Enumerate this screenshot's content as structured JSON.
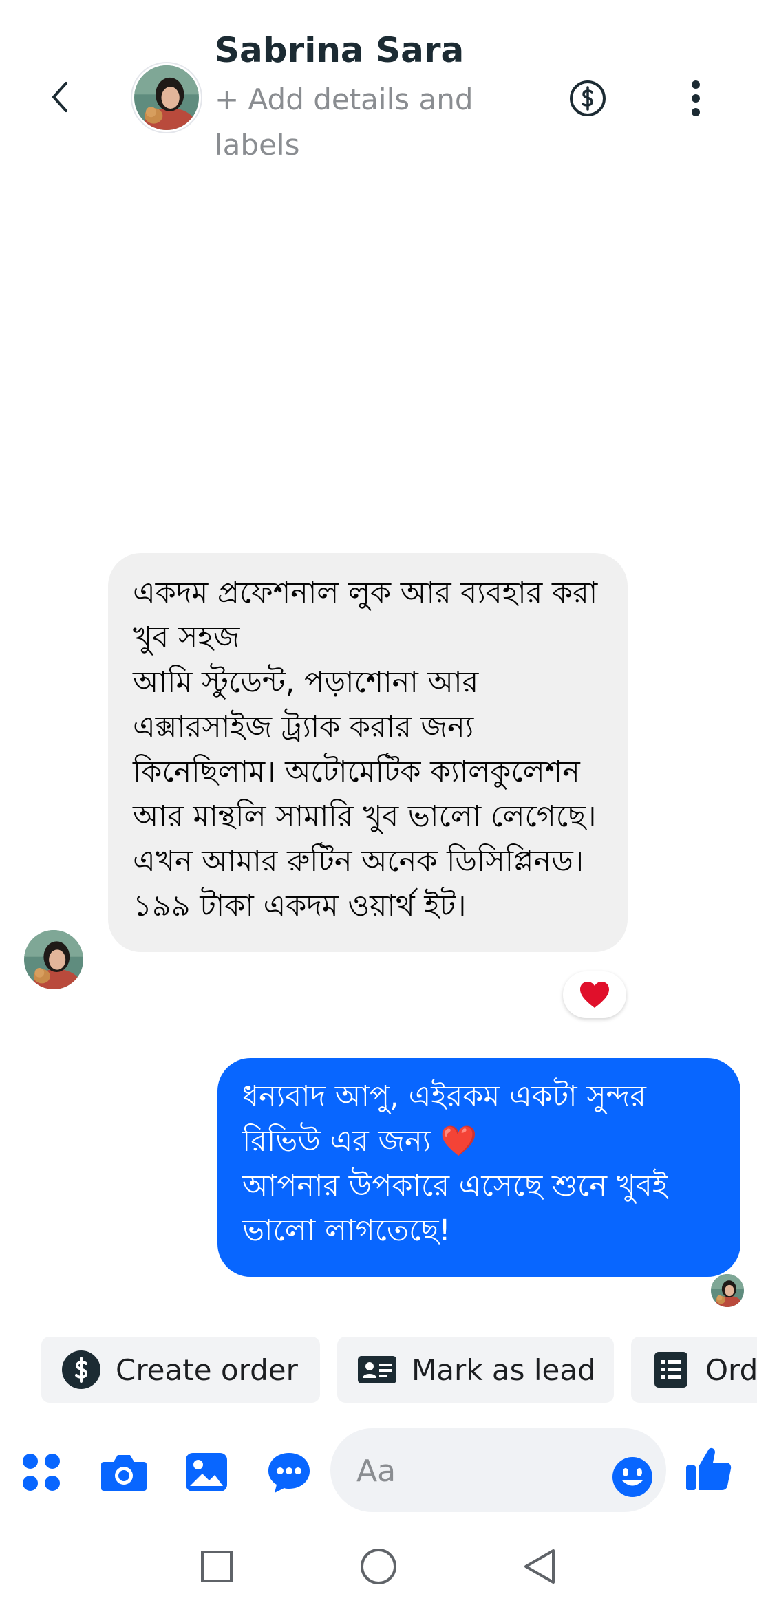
{
  "header": {
    "back_icon": "chevron-left-icon",
    "contact_name": "Sabrina Sara",
    "add_details": "+ Add details and labels",
    "payment_icon": "dollar-circle-icon",
    "menu_icon": "kebab-menu-icon"
  },
  "messages": [
    {
      "direction": "incoming",
      "text": "একদম প্রফেশনাল লুক আর ব্যবহার করা খুব সহজ\nআমি স্টুডেন্ট, পড়াশোনা আর এক্সারসাইজ ট্র্যাক করার জন্য কিনেছিলাম। অটোমেটিক ক্যালকুলেশন আর মান্থলি সামারি খুব ভালো লেগেছে। এখন আমার রুটিন অনেক ডিসিপ্লিনড। ১৯৯ টাকা একদম ওয়ার্থ ইট।",
      "reaction": "❤️"
    },
    {
      "direction": "outgoing",
      "text": "ধন্যবাদ আপু, এইরকম একটা সুন্দর রিভিউ এর জন্য ❤️\nআপনার উপকারে এসেছে শুনে খুবই ভালো লাগতেছে!"
    }
  ],
  "quick_actions": [
    {
      "label": "Create order",
      "icon": "dollar-circle-icon"
    },
    {
      "label": "Mark as lead",
      "icon": "contact-card-icon"
    },
    {
      "label": "Ord",
      "icon": "order-list-icon"
    }
  ],
  "composer": {
    "placeholder": "Aa",
    "tools": [
      "apps-grid-icon",
      "camera-icon",
      "gallery-icon",
      "chat-bubble-icon"
    ],
    "emoji_icon": "smiley-icon",
    "send_icon": "thumbs-up-icon"
  },
  "system_nav": [
    "square-icon",
    "circle-icon",
    "back-triangle-icon"
  ],
  "colors": {
    "accent": "#0866ff",
    "incoming_bubble": "#f0f0f0",
    "chip_bg": "#f2f3f5",
    "icon_dark": "#1c2b33"
  }
}
